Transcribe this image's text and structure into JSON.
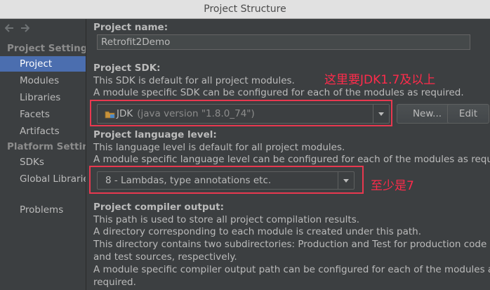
{
  "window": {
    "title": "Project Structure"
  },
  "sidebar": {
    "section_project": "Project Settings",
    "project_items": [
      "Project",
      "Modules",
      "Libraries",
      "Facets",
      "Artifacts"
    ],
    "section_platform": "Platform Settings",
    "platform_items": [
      "SDKs",
      "Global Libraries"
    ],
    "problems": "Problems"
  },
  "project_name": {
    "label": "Project name:",
    "value": "Retrofit2Demo"
  },
  "project_sdk": {
    "label": "Project SDK:",
    "desc1": "This SDK is default for all project modules.",
    "desc2": "A module specific SDK can be configured for each of the modules as required.",
    "selected_name": "JDK",
    "selected_detail": "(java version \"1.8.0_74\")",
    "new_button": "New...",
    "edit_button": "Edit"
  },
  "language_level": {
    "label": "Project language level:",
    "desc1": "This language level is default for all project modules.",
    "desc2": "A module specific language level can be configured for each of the modules as required.",
    "selected": "8 - Lambdas, type annotations etc."
  },
  "compiler_output": {
    "label": "Project compiler output:",
    "line1": "This path is used to store all project compilation results.",
    "line2": "A directory corresponding to each module is created under this path.",
    "line3": "This directory contains two subdirectories: Production and Test for production code",
    "line4": "and test sources, respectively.",
    "line5": "A module specific compiler output path can be configured for each of the modules as",
    "line6": "required."
  },
  "annotations": {
    "sdk_note": "这里要JDK1.7及以上",
    "level_note": "至少是7"
  },
  "colors": {
    "selection": "#4b6eaf",
    "annotation_red": "#ff2b4b",
    "background": "#3c3f41"
  }
}
